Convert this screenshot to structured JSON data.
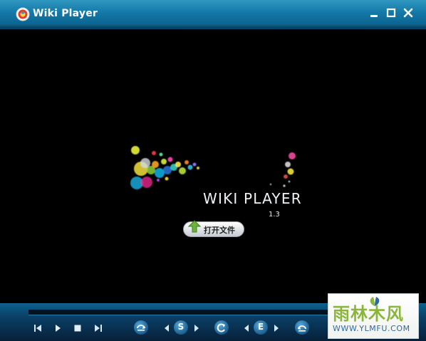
{
  "window": {
    "title": "Wiki Player"
  },
  "video": {
    "logo": {
      "name": "WIKI PLAYER",
      "version": "1.3"
    },
    "open_file_label": "打开文件"
  },
  "controls": {
    "subtitle_letter": "S",
    "eq_letter": "E"
  },
  "watermark": {
    "text": "雨林木风",
    "url": "WWW.YLMFU.COM"
  },
  "colors": {
    "titlebar": "#1378a7",
    "controlbar": "#0a3f66",
    "video_bg": "#000000",
    "accent_green": "#8ab63a"
  }
}
